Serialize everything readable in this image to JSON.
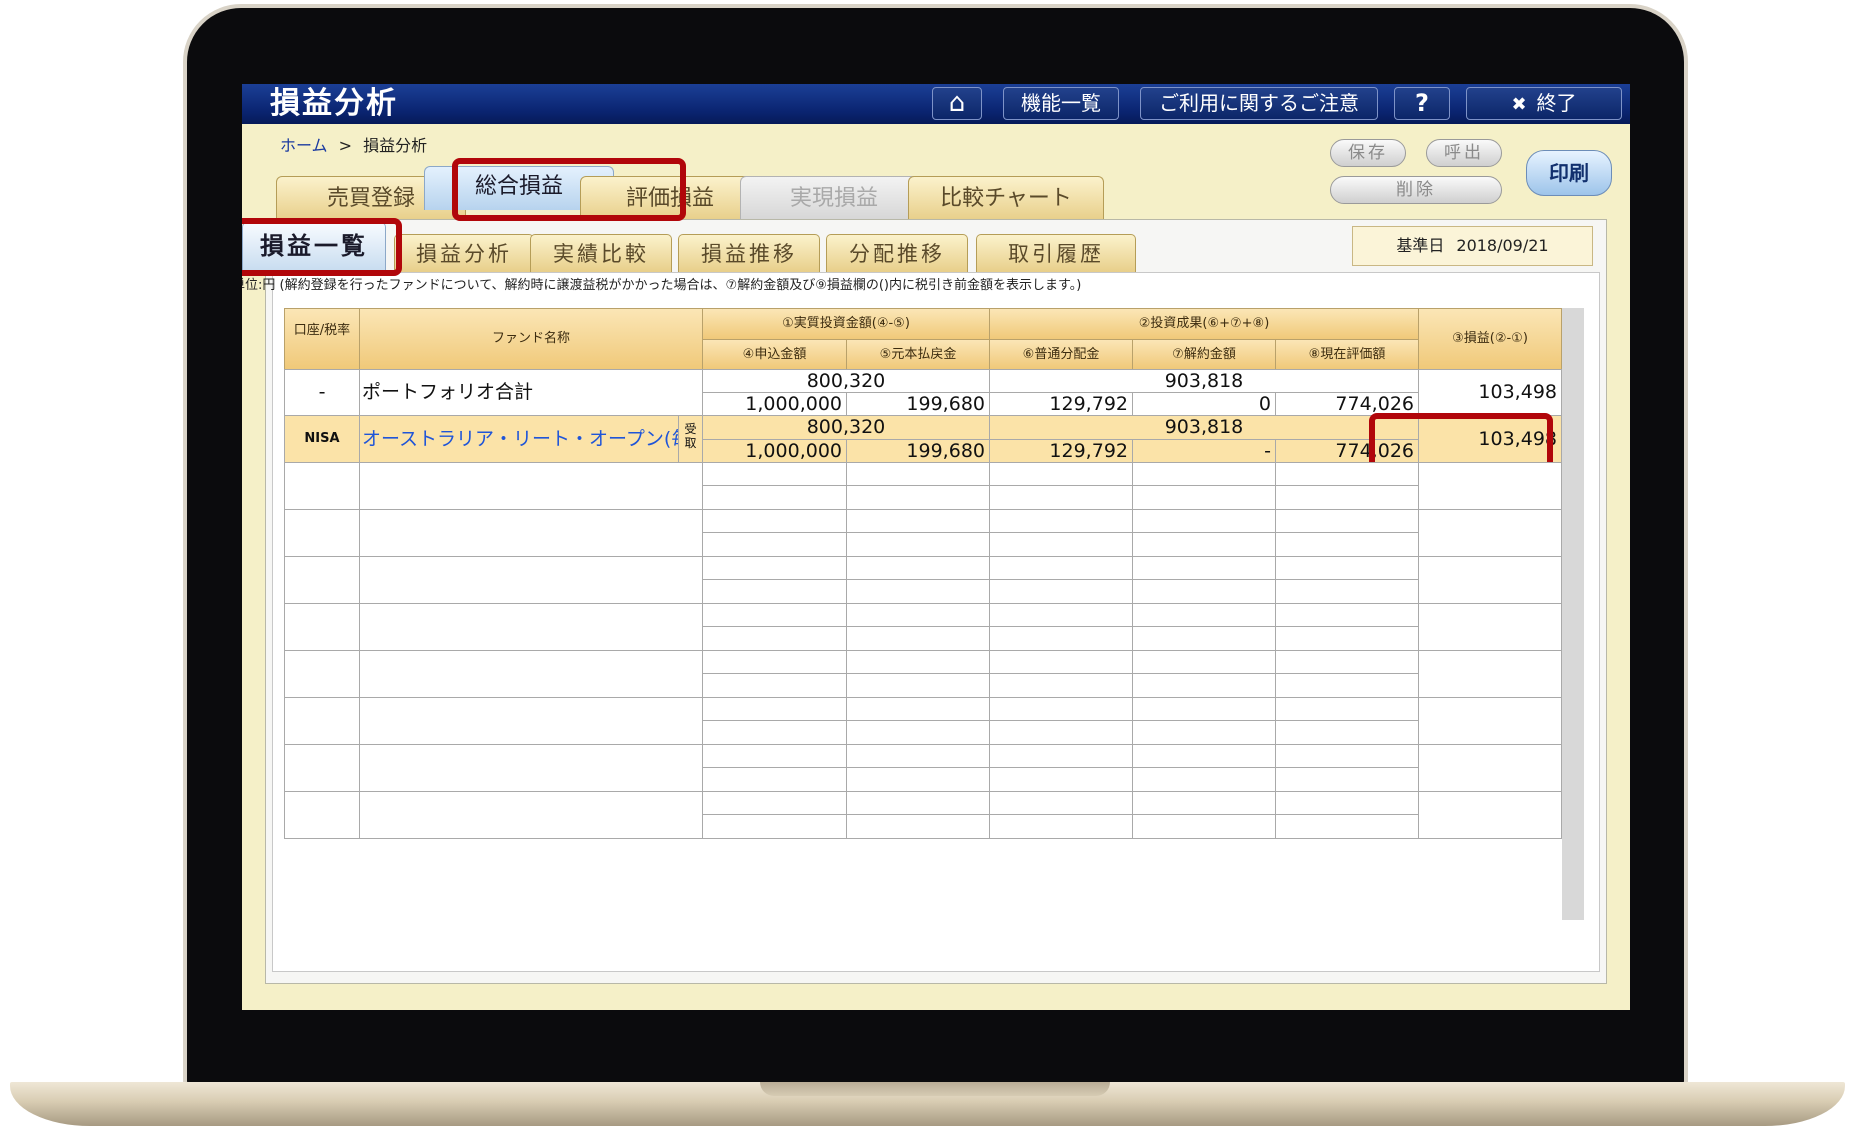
{
  "window": {
    "title": "損益分析",
    "buttons": {
      "home_icon": "⌂",
      "function_list": "機能一覧",
      "notice": "ご利用に関するご注意",
      "help": "?",
      "exit_icon": "✖",
      "exit": "終了"
    }
  },
  "breadcrumb": {
    "home": "ホーム",
    "separator": ">",
    "current": "損益分析"
  },
  "actions": {
    "save": "保存",
    "load": "呼出",
    "delete": "削除",
    "print": "印刷"
  },
  "main_tabs": [
    {
      "label": "売買登録",
      "state": "normal"
    },
    {
      "label": "総合損益",
      "state": "active"
    },
    {
      "label": "評価損益",
      "state": "normal"
    },
    {
      "label": "実現損益",
      "state": "disabled"
    },
    {
      "label": "比較チャート",
      "state": "normal"
    }
  ],
  "sub_tabs": [
    {
      "label": "損益一覧",
      "state": "active"
    },
    {
      "label": "損益分析",
      "state": "normal"
    },
    {
      "label": "実績比較",
      "state": "normal"
    },
    {
      "label": "損益推移",
      "state": "normal"
    },
    {
      "label": "分配推移",
      "state": "normal"
    },
    {
      "label": "取引履歴",
      "state": "normal"
    }
  ],
  "base_date": {
    "label": "基準日",
    "value": "2018/09/21"
  },
  "unit_note": "単位:円 (解約登録を行ったファンドについて、解約時に譲渡益税がかかった場合は、⑦解約金額及び⑨損益欄の()内に税引き前金額を表示します。)",
  "table": {
    "headers": {
      "account": "口座/税率",
      "fund_name": "ファンド名称",
      "invest_group": "①実質投資金額(④-⑤)",
      "result_group": "②投資成果(⑥+⑦+⑧)",
      "profit": "③損益(②-①)",
      "col4": "④申込金額",
      "col5": "⑤元本払戻金",
      "col6": "⑥普通分配金",
      "col7": "⑦解約金額",
      "col8": "⑧現在評価額"
    },
    "rows": [
      {
        "account": "-",
        "fund_name": "ポートフォリオ合計",
        "receive": "",
        "invest_total": "800,320",
        "result_total": "903,818",
        "apply_amount": "1,000,000",
        "principal_refund": "199,680",
        "ordinary_dist": "129,792",
        "cancel_amount": "0",
        "current_value": "774,026",
        "profit": "103,498"
      },
      {
        "account": "NISA",
        "fund_name": "オーストラリア・リート・オープン(毎",
        "receive": "受取",
        "invest_total": "800,320",
        "result_total": "903,818",
        "apply_amount": "1,000,000",
        "principal_refund": "199,680",
        "ordinary_dist": "129,792",
        "cancel_amount": "-",
        "current_value": "774,026",
        "profit": "103,498"
      }
    ],
    "empty_rows": 8
  },
  "colors": {
    "title_bar": "#0a2470",
    "highlight": "#b1060a",
    "nisa_row": "#fbe3a8",
    "header": "#f0c979"
  }
}
